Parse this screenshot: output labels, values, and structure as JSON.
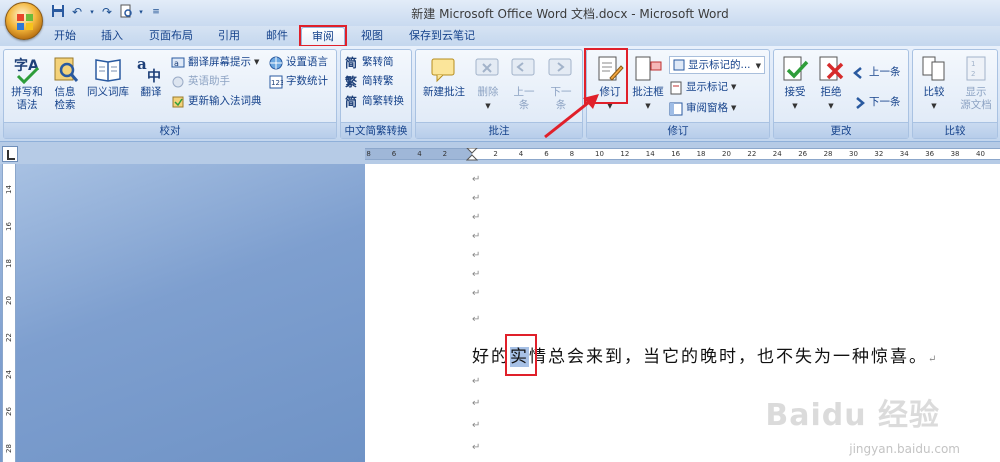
{
  "window": {
    "title": "新建 Microsoft Office Word 文档.docx - Microsoft Word"
  },
  "tabs": [
    {
      "label": "开始"
    },
    {
      "label": "插入"
    },
    {
      "label": "页面布局"
    },
    {
      "label": "引用"
    },
    {
      "label": "邮件"
    },
    {
      "label": "审阅"
    },
    {
      "label": "视图"
    },
    {
      "label": "保存到云笔记"
    }
  ],
  "ribbon": {
    "proofing": {
      "label": "校对",
      "spelling": "拼写和\n语法",
      "research": "信息\n检索",
      "thesaurus": "同义词库",
      "translate": "翻译",
      "translate_tip": "翻译屏幕提示",
      "english_helper": "英语助手",
      "update_ime": "更新输入法词典",
      "set_language": "设置语言",
      "word_count": "字数统计"
    },
    "chinese_conversion": {
      "label": "中文简繁转换",
      "to_simplified": "繁转简",
      "to_traditional": "简转繁",
      "convert": "简繁转换"
    },
    "comments": {
      "label": "批注",
      "new_comment": "新建批注",
      "delete": "删除",
      "previous": "上一\n条",
      "next": "下一\n条"
    },
    "tracking": {
      "label": "修订",
      "track_changes": "修订",
      "balloons": "批注框",
      "display_select": "显示标记的...",
      "show_markup": "显示标记",
      "reviewing_pane": "审阅窗格"
    },
    "changes": {
      "label": "更改",
      "accept": "接受",
      "reject": "拒绝",
      "previous": "上一条",
      "next": "下一条"
    },
    "compare": {
      "label": "比较",
      "compare": "比较",
      "show_source": "显示\n源文档"
    }
  },
  "ruler": {
    "h_ticks": [
      "8",
      "6",
      "4",
      "2",
      "2",
      "4",
      "6",
      "8",
      "10",
      "12",
      "14",
      "16",
      "18",
      "20",
      "22",
      "24",
      "26",
      "28",
      "30",
      "32",
      "34",
      "36",
      "38",
      "40"
    ],
    "v_ticks": [
      "14",
      "16",
      "18",
      "20",
      "22",
      "24",
      "26",
      "28"
    ]
  },
  "document": {
    "before": "好的",
    "highlight": "实",
    "after": "情总会来到，当它的晚时，也不失为一种惊喜。",
    "para_mark": "↵"
  },
  "watermark": {
    "brand": "Baidu 经验",
    "url": "jingyan.baidu.com"
  }
}
